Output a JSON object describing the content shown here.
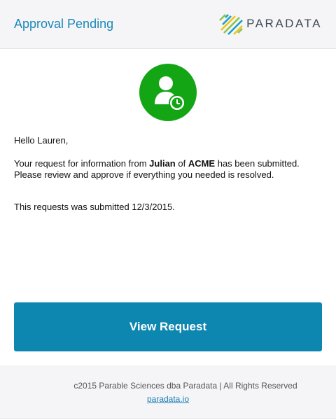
{
  "header": {
    "title": "Approval Pending",
    "brand_name": "PARADATA"
  },
  "status_icon": "user-clock-icon",
  "email": {
    "greeting": "Hello Lauren,",
    "message_part1": "Your request for information from ",
    "requester_name": "Julian",
    "message_part2": " of ",
    "company_name": "ACME",
    "message_part3": " has been submitted. Please review and approve if everything you needed is resolved.",
    "submitted_text": "This requests was submitted 12/3/2015."
  },
  "cta": {
    "label": "View Request"
  },
  "footer": {
    "copyright": "c2015  Parable Sciences dba Paradata | All Rights Reserved",
    "link_text": "paradata.io"
  },
  "colors": {
    "accent": "#1a88b8",
    "button": "#0d86b0",
    "status_green": "#14a515"
  }
}
